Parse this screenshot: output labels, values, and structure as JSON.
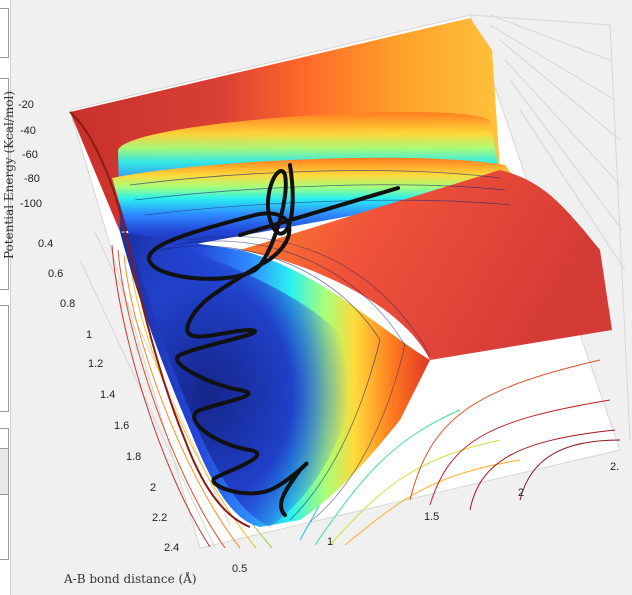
{
  "chart_data": {
    "type": "surface3d",
    "zlabel": "Potential Energy (Kcal/mol)",
    "xlabel": "A-B bond distance (Å)",
    "z_ticks": [
      "-20",
      "-40",
      "-60",
      "-80",
      "-100"
    ],
    "y_ticks": [
      "0.4",
      "0.6",
      "0.8",
      "1",
      "1.2",
      "1.4",
      "1.6",
      "1.8",
      "2",
      "2.2",
      "2.4"
    ],
    "x_ticks": [
      "0.5",
      "1",
      "1.5",
      "2",
      "2."
    ],
    "colormap": [
      "#1a2f9e",
      "#2f55e8",
      "#23a8ff",
      "#22f0f0",
      "#8dffa0",
      "#f5f540",
      "#ffae2a",
      "#ff4a1a",
      "#c8302c"
    ]
  }
}
